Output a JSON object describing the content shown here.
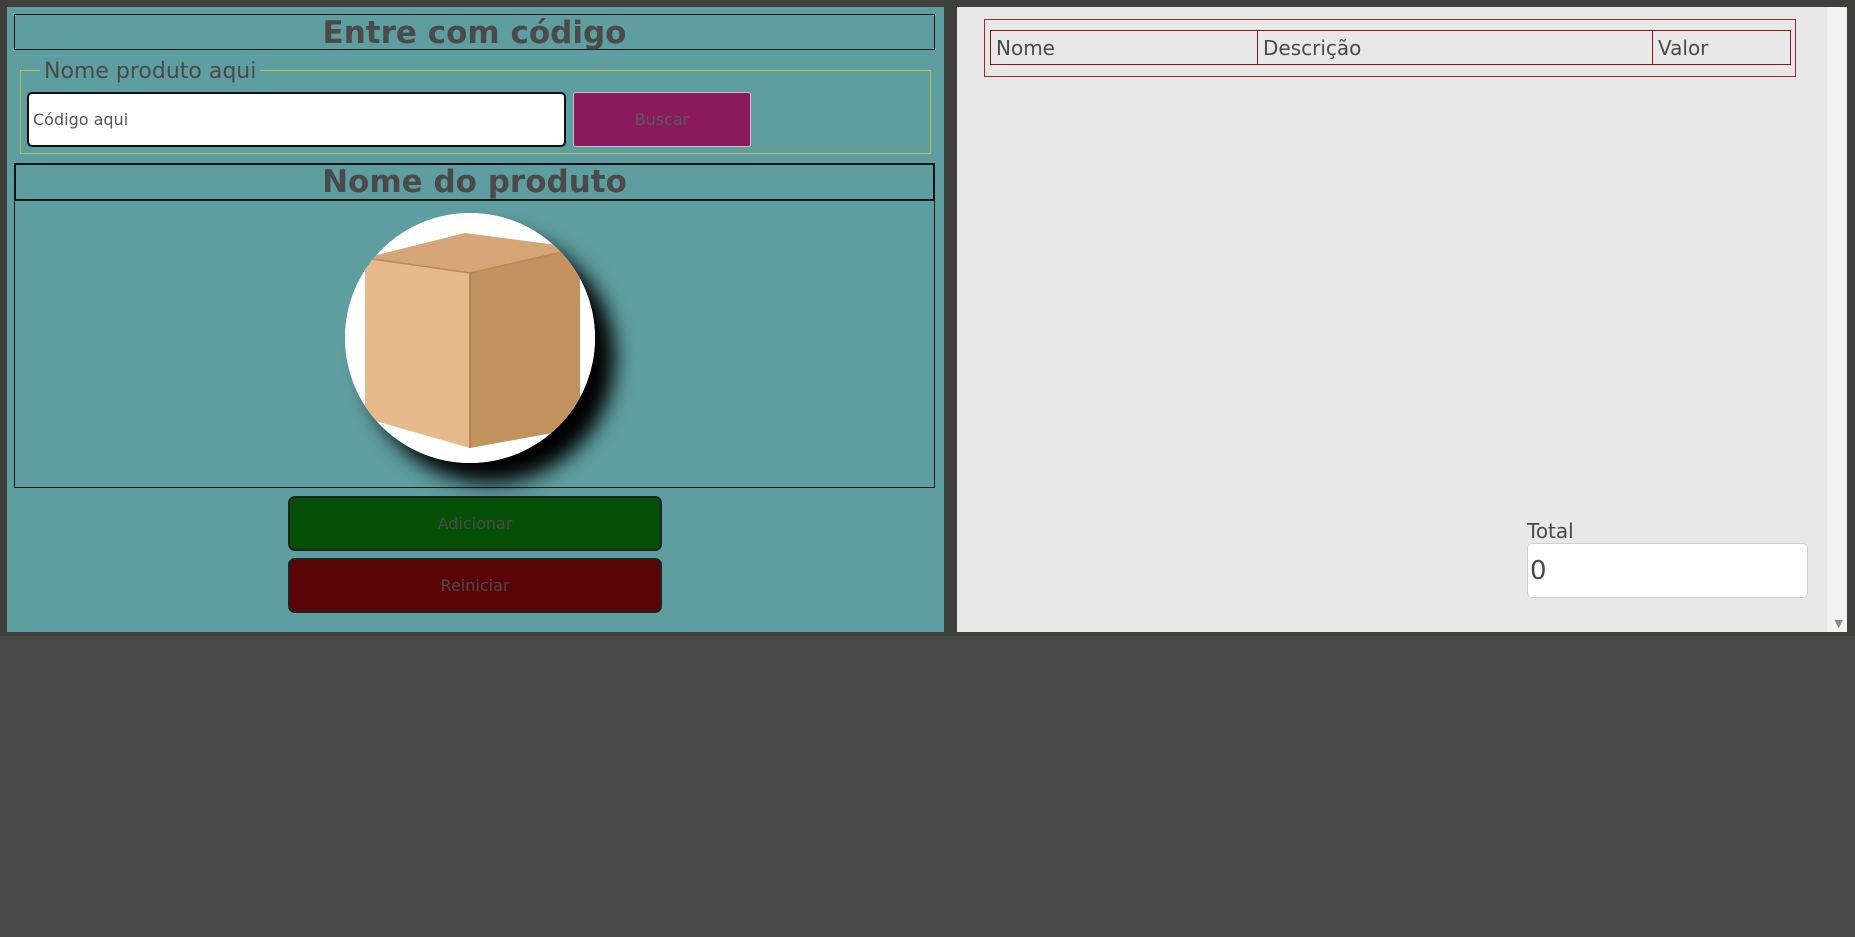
{
  "left": {
    "code_header": "Entre com código",
    "fieldset_legend": "Nome produto aqui",
    "code_input": {
      "placeholder": "Código aqui",
      "value": ""
    },
    "search_button": "Buscar",
    "product_header": "Nome do produto",
    "product_image_icon": "cardboard-box-icon",
    "add_button": "Adicionar",
    "reset_button": "Reiniciar"
  },
  "right": {
    "table": {
      "columns": [
        "Nome",
        "Descrição",
        "Valor"
      ],
      "rows": []
    },
    "total_label": "Total",
    "total_value": "0"
  },
  "colors": {
    "left_panel_bg": "#5f9ea0",
    "search_button_bg": "#8b1a5c",
    "add_button_bg": "#064f06",
    "reset_button_bg": "#5a0505",
    "right_panel_bg": "#e8e8e8",
    "page_bg": "#484848"
  }
}
